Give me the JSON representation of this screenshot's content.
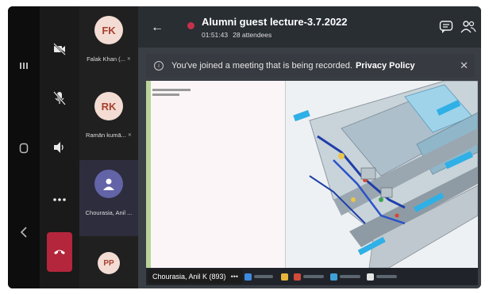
{
  "meeting": {
    "title": "Alumni guest lecture-3.7.2022",
    "elapsed": "01:51:43",
    "attendees": "28 attendees"
  },
  "banner": {
    "text": "You've joined a meeting that is being recorded.",
    "link": "Privacy Policy"
  },
  "participants": [
    {
      "initials": "FK",
      "name": "Falak Khan (..."
    },
    {
      "initials": "RK",
      "name": "Ramān kumā..."
    },
    {
      "initials": "",
      "name": "Chourasia, Anil ..."
    },
    {
      "initials": "PP",
      "name": ""
    }
  ],
  "presenter": {
    "name": "Chourasia, Anil K (893)"
  },
  "colors": {
    "leave": "#b3263b",
    "teams_purple": "#6264a7",
    "recording": "#c4314b"
  }
}
